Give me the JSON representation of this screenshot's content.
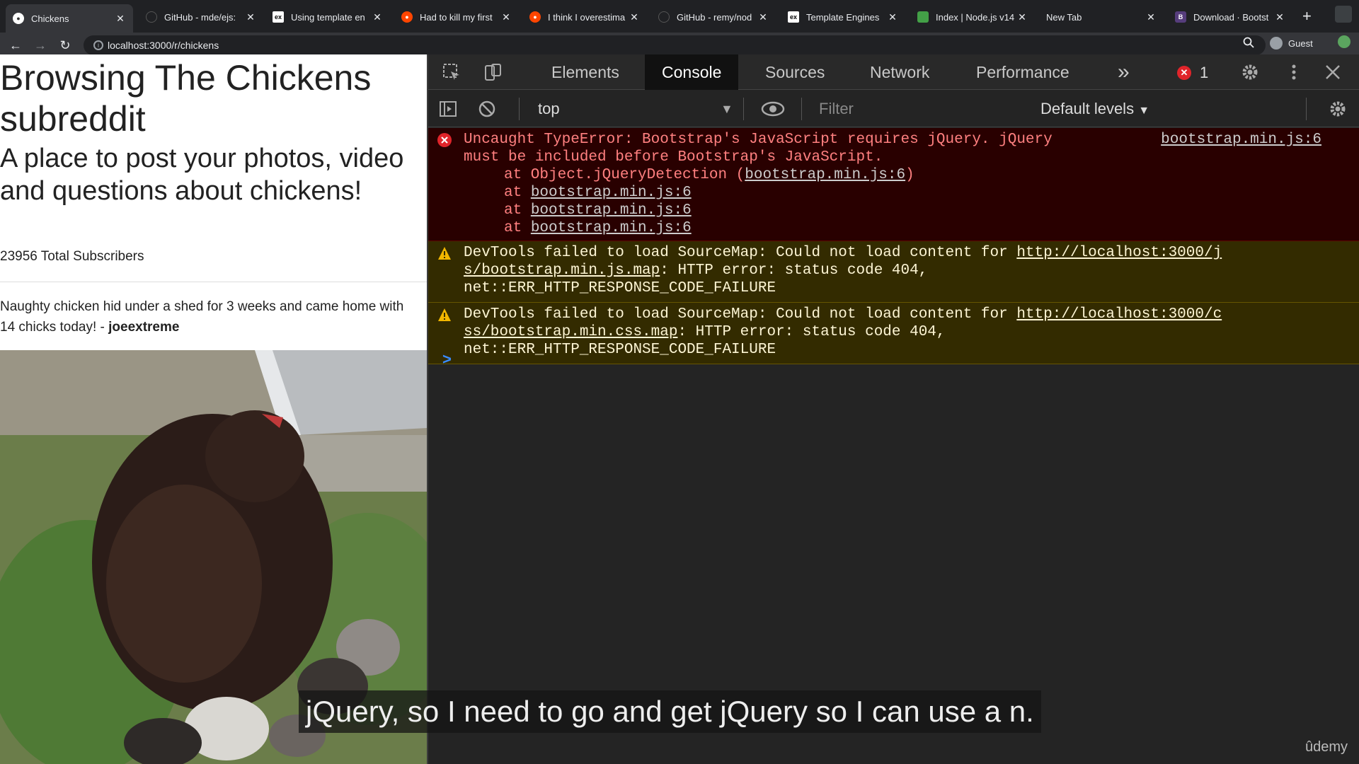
{
  "tabs": [
    {
      "label": "Chickens",
      "icon": "reddit-icon",
      "active": true
    },
    {
      "label": "GitHub - mde/ejs:",
      "icon": "github-icon"
    },
    {
      "label": "Using template en",
      "icon": "express-icon"
    },
    {
      "label": "Had to kill my first",
      "icon": "reddit-icon"
    },
    {
      "label": "I think I overestima",
      "icon": "reddit-icon"
    },
    {
      "label": "GitHub - remy/nod",
      "icon": "github-icon"
    },
    {
      "label": "Template Engines",
      "icon": "express-icon"
    },
    {
      "label": "Index | Node.js v14",
      "icon": "nodejs-icon"
    },
    {
      "label": "New Tab",
      "icon": ""
    },
    {
      "label": "Download · Bootst",
      "icon": "bootstrap-icon"
    }
  ],
  "address": {
    "url": "localhost:3000/r/chickens"
  },
  "profile": {
    "label": "Guest"
  },
  "page": {
    "title": "Browsing The Chickens subreddit",
    "description": "A place to post your photos, video and questions about chickens!",
    "subscribers": "23956 Total Subscribers",
    "post_title": "Naughty chicken hid under a shed for 3 weeks and came home with 14 chicks today! -",
    "post_author": "joeextreme"
  },
  "devtools": {
    "tabs": [
      "Elements",
      "Console",
      "Sources",
      "Network",
      "Performance"
    ],
    "active_tab": "Console",
    "more": "»",
    "error_count": "1",
    "context": "top",
    "filter_placeholder": "Filter",
    "levels": "Default levels"
  },
  "console": {
    "error": {
      "line1": "Uncaught TypeError: Bootstrap's JavaScript requires jQuery. jQuery",
      "line2": "must be included before Bootstrap's JavaScript.",
      "trace1_prefix": "at Object.jQueryDetection (",
      "trace1_link": "bootstrap.min.js:6",
      "trace1_suffix": ")",
      "trace_at": "at",
      "trace_link": "bootstrap.min.js:6",
      "source": "bootstrap.min.js:6"
    },
    "warn1": {
      "text1": "DevTools failed to load SourceMap: Could not load content for ",
      "link1": "http://localhost:3000/j",
      "link2": "s/bootstrap.min.js.map",
      "text2": ": HTTP error: status code 404,",
      "text3": "net::ERR_HTTP_RESPONSE_CODE_FAILURE"
    },
    "warn2": {
      "text1": "DevTools failed to load SourceMap: Could not load content for ",
      "link1": "http://localhost:3000/c",
      "link2": "ss/bootstrap.min.css.map",
      "text2": ": HTTP error: status code 404,",
      "text3": "net::ERR_HTTP_RESPONSE_CODE_FAILURE"
    },
    "prompt": ">"
  },
  "caption": "jQuery, so I need to go and get jQuery so I can use a n.",
  "watermark": "ûdemy",
  "colors": {
    "error_bg": "#290000",
    "error_text": "#ff8080",
    "warn_bg": "#332b00",
    "accent": "#3a8cff"
  }
}
